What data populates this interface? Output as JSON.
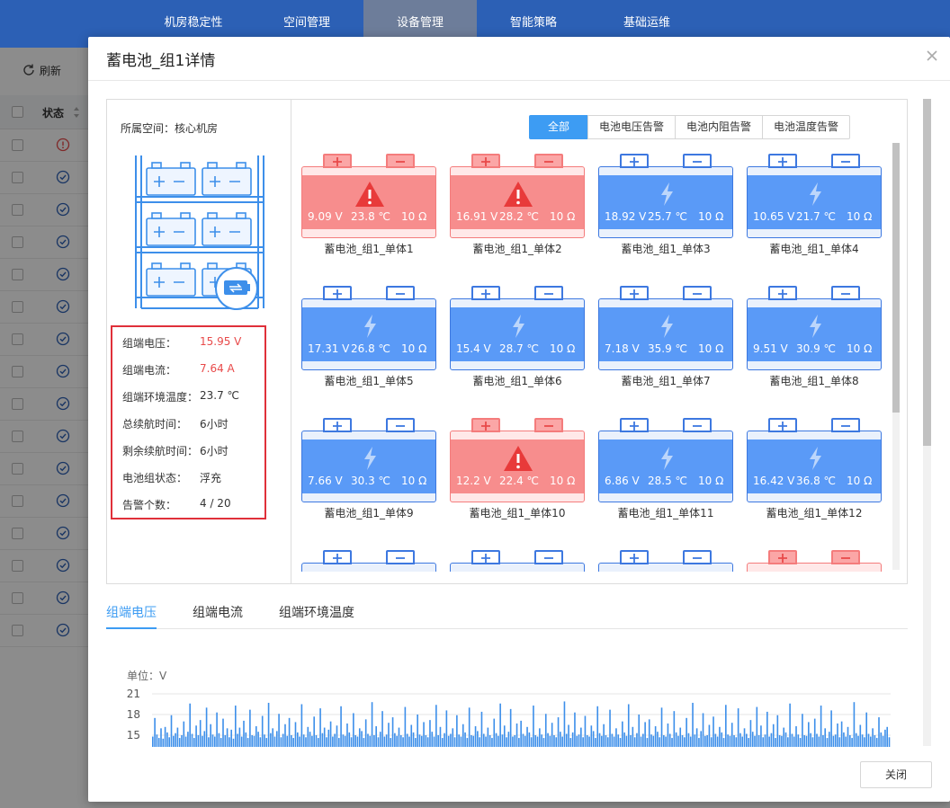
{
  "top_nav": {
    "items": [
      {
        "label": "机房稳定性",
        "active": false
      },
      {
        "label": "空间管理",
        "active": false
      },
      {
        "label": "设备管理",
        "active": true
      },
      {
        "label": "智能策略",
        "active": false
      },
      {
        "label": "基础运维",
        "active": false
      }
    ]
  },
  "background": {
    "refresh_label": "刷新",
    "status_header": "状态",
    "rows": [
      "alarm",
      "ok",
      "ok",
      "ok",
      "ok",
      "ok",
      "ok",
      "ok",
      "ok",
      "ok",
      "ok",
      "ok",
      "ok",
      "ok",
      "ok",
      "ok"
    ]
  },
  "modal": {
    "title": "蓄电池_组1详情",
    "close_label": "关闭",
    "space_label": "所属空间：核心机房",
    "info": [
      {
        "label": "组端电压：",
        "value": "15.95 V",
        "highlight": true
      },
      {
        "label": "组端电流：",
        "value": "7.64 A",
        "highlight": true
      },
      {
        "label": "组端环境温度：",
        "value": "23.7 ℃",
        "highlight": false
      },
      {
        "label": "总续航时间：",
        "value": "6小时",
        "highlight": false
      },
      {
        "label": "剩余续航时间：",
        "value": "6小时",
        "highlight": false
      },
      {
        "label": "电池组状态：",
        "value": "浮充",
        "highlight": false
      },
      {
        "label": "告警个数：",
        "value": "4 / 20",
        "highlight": false
      }
    ],
    "filters": [
      {
        "label": "全部",
        "active": true
      },
      {
        "label": "电池电压告警",
        "active": false
      },
      {
        "label": "电池内阻告警",
        "active": false
      },
      {
        "label": "电池温度告警",
        "active": false
      }
    ],
    "cells": [
      {
        "name": "蓄电池_组1_单体1",
        "voltage": "9.09 V",
        "temp": "23.8 ℃",
        "resistance": "10 Ω",
        "alarm": true
      },
      {
        "name": "蓄电池_组1_单体2",
        "voltage": "16.91 V",
        "temp": "28.2 ℃",
        "resistance": "10 Ω",
        "alarm": true
      },
      {
        "name": "蓄电池_组1_单体3",
        "voltage": "18.92 V",
        "temp": "25.7 ℃",
        "resistance": "10 Ω",
        "alarm": false
      },
      {
        "name": "蓄电池_组1_单体4",
        "voltage": "10.65 V",
        "temp": "21.7 ℃",
        "resistance": "10 Ω",
        "alarm": false
      },
      {
        "name": "蓄电池_组1_单体5",
        "voltage": "17.31 V",
        "temp": "26.8 ℃",
        "resistance": "10 Ω",
        "alarm": false
      },
      {
        "name": "蓄电池_组1_单体6",
        "voltage": "15.4 V",
        "temp": "28.7 ℃",
        "resistance": "10 Ω",
        "alarm": false
      },
      {
        "name": "蓄电池_组1_单体7",
        "voltage": "7.18 V",
        "temp": "35.9 ℃",
        "resistance": "10 Ω",
        "alarm": false
      },
      {
        "name": "蓄电池_组1_单体8",
        "voltage": "9.51 V",
        "temp": "30.9 ℃",
        "resistance": "10 Ω",
        "alarm": false
      },
      {
        "name": "蓄电池_组1_单体9",
        "voltage": "7.66 V",
        "temp": "30.3 ℃",
        "resistance": "10 Ω",
        "alarm": false
      },
      {
        "name": "蓄电池_组1_单体10",
        "voltage": "12.2 V",
        "temp": "22.4 ℃",
        "resistance": "10 Ω",
        "alarm": true
      },
      {
        "name": "蓄电池_组1_单体11",
        "voltage": "6.86 V",
        "temp": "28.5 ℃",
        "resistance": "10 Ω",
        "alarm": false
      },
      {
        "name": "蓄电池_组1_单体12",
        "voltage": "16.42 V",
        "temp": "36.8 ℃",
        "resistance": "10 Ω",
        "alarm": false
      },
      {
        "name": "",
        "voltage": "",
        "temp": "",
        "resistance": "",
        "alarm": false
      },
      {
        "name": "",
        "voltage": "",
        "temp": "",
        "resistance": "",
        "alarm": false
      },
      {
        "name": "",
        "voltage": "",
        "temp": "",
        "resistance": "",
        "alarm": false
      },
      {
        "name": "",
        "voltage": "",
        "temp": "",
        "resistance": "",
        "alarm": true
      }
    ],
    "chart_tabs": [
      {
        "label": "组端电压",
        "active": true
      },
      {
        "label": "组端电流",
        "active": false
      },
      {
        "label": "组端环境温度",
        "active": false
      }
    ]
  },
  "colors": {
    "accent": "#3d9cf3",
    "alarm": "#e84a4a",
    "cell_normal": "#5a9af7",
    "cell_alarm": "#f78d8d"
  },
  "chart_data": {
    "type": "bar",
    "unit_label": "单位：V",
    "ylim": [
      12,
      21
    ],
    "yticks": [
      21,
      18,
      15
    ],
    "series": [
      {
        "values": [
          14.8,
          17.5,
          15.1,
          14.6,
          16.0,
          14.5,
          16.2,
          15.4,
          14.7,
          17.9,
          14.9,
          15.3,
          16.1,
          14.6,
          15.0,
          17.0,
          14.8,
          15.5,
          19.6,
          15.2,
          14.6,
          16.4,
          15.0,
          17.2,
          14.9,
          15.6,
          19.0,
          14.7,
          16.6,
          15.1,
          14.8,
          18.3,
          15.3,
          14.6,
          17.4,
          15.0,
          16.0,
          14.7,
          15.8,
          14.5,
          19.3,
          15.2,
          16.1,
          14.8,
          17.1,
          15.4,
          14.6,
          18.7,
          15.0,
          14.9,
          16.3,
          15.5,
          14.7,
          17.8,
          15.1,
          14.6,
          19.7,
          15.3,
          16.0,
          14.8,
          15.6,
          18.1,
          14.7,
          15.2,
          16.6,
          14.9,
          17.5,
          15.0,
          14.6,
          16.9,
          15.4,
          14.8,
          19.5,
          15.1,
          14.7,
          16.2,
          15.5,
          14.9,
          17.7,
          15.0,
          14.6,
          18.9,
          15.3,
          16.1,
          14.7,
          15.8,
          17.0,
          14.8,
          15.2,
          16.4,
          14.6,
          19.2,
          15.1,
          14.9,
          16.7,
          15.4,
          14.7,
          18.2,
          15.0,
          14.8,
          16.0,
          15.6,
          14.6,
          17.3,
          15.2,
          14.9,
          19.8,
          15.0,
          16.3,
          14.7,
          15.5,
          18.5,
          14.8,
          15.1,
          16.8,
          14.6,
          17.6,
          15.3,
          14.9,
          16.1,
          15.0,
          14.7,
          19.1,
          15.2,
          14.8,
          16.5,
          15.4,
          14.6,
          18.0,
          15.1,
          14.9,
          16.9,
          15.0,
          14.7,
          17.2,
          15.5,
          14.8,
          19.4,
          15.0,
          16.2,
          14.6,
          15.3,
          18.6,
          14.9,
          15.2,
          16.0,
          14.7,
          17.9,
          15.1,
          14.8,
          16.6,
          15.4,
          14.6,
          19.0,
          15.0,
          14.9,
          16.3,
          15.6,
          14.7,
          18.4,
          15.2,
          14.8,
          16.1,
          15.0,
          14.6,
          17.4,
          15.3,
          14.9,
          19.6,
          15.1,
          16.4,
          14.7,
          15.5,
          18.8,
          14.8,
          15.0,
          16.7,
          14.6,
          17.1,
          15.2,
          14.9,
          16.2,
          15.4,
          14.7,
          19.3,
          15.0,
          14.8,
          16.0,
          15.1,
          14.6,
          18.1,
          15.3,
          14.9,
          16.8,
          15.0,
          14.7,
          17.6,
          15.5,
          14.8,
          19.9,
          15.2,
          16.5,
          14.6,
          15.4,
          18.3,
          14.9,
          15.1,
          16.1,
          14.7,
          17.8,
          15.0,
          14.8,
          16.4,
          15.6,
          14.6,
          19.2,
          15.3,
          14.9,
          16.6,
          15.0,
          14.7,
          18.7,
          15.2,
          14.8,
          16.0,
          15.1,
          14.6,
          17.0,
          15.4,
          14.9,
          19.5,
          15.0,
          16.2,
          14.7,
          15.3,
          18.0,
          14.8,
          15.2,
          16.9,
          14.6,
          17.3,
          15.1,
          14.9,
          16.3,
          15.5,
          14.7,
          19.0,
          15.0,
          14.8,
          16.7,
          15.2,
          14.6,
          18.5,
          15.4,
          14.9,
          16.1,
          15.0,
          14.7,
          17.5,
          15.3,
          14.8,
          19.7,
          15.1,
          16.0,
          14.6,
          15.6,
          18.2,
          14.9,
          15.0,
          16.5,
          14.7,
          17.7,
          15.2,
          14.8,
          16.2,
          15.4,
          14.6,
          19.4,
          15.1,
          14.9,
          16.8,
          15.0,
          14.7,
          18.9,
          15.3,
          14.8,
          16.0,
          15.2,
          14.6,
          17.2,
          15.5,
          14.9,
          19.1,
          15.0,
          16.4,
          14.7,
          15.1,
          18.4,
          14.8,
          15.3,
          16.6,
          14.6,
          17.9,
          15.0,
          14.9,
          16.1,
          15.4,
          14.7,
          19.6,
          15.2,
          14.8,
          16.3,
          15.1,
          14.6,
          18.1,
          15.0,
          14.9,
          16.9,
          15.3,
          14.7,
          17.4,
          15.2,
          14.8,
          19.3,
          15.0,
          16.0,
          14.6,
          15.5,
          18.6,
          14.9,
          15.1,
          16.7,
          14.7,
          17.0,
          15.4,
          14.8,
          16.2,
          15.0,
          14.6,
          19.8,
          15.3,
          14.9,
          16.5,
          15.1,
          14.7,
          18.3,
          15.2,
          14.8,
          16.0,
          15.0,
          14.6,
          17.6,
          15.4,
          14.9,
          15.8,
          16.2,
          14.7
        ]
      }
    ]
  }
}
